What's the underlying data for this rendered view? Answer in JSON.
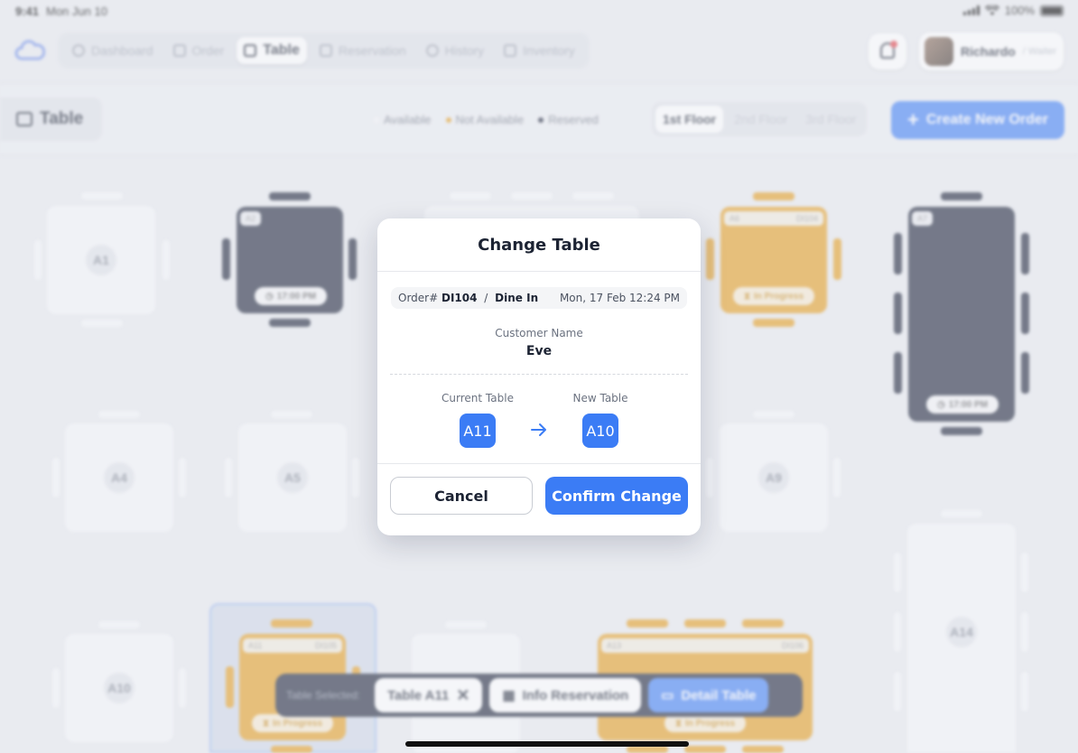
{
  "status_bar": {
    "time": "9:41",
    "date": "Mon Jun 10",
    "battery": "100%"
  },
  "nav": {
    "items": [
      {
        "label": "Dashboard",
        "icon": "dashboard-icon",
        "active": false
      },
      {
        "label": "Order",
        "icon": "order-icon",
        "active": false
      },
      {
        "label": "Table",
        "icon": "table-icon",
        "active": true
      },
      {
        "label": "Reservation",
        "icon": "calendar-icon",
        "active": false
      },
      {
        "label": "History",
        "icon": "history-icon",
        "active": false
      },
      {
        "label": "Inventory",
        "icon": "inventory-icon",
        "active": false
      }
    ]
  },
  "user": {
    "name": "Richardo",
    "role": "/ Waiter"
  },
  "toolbar": {
    "page_title": "Table",
    "legend": [
      {
        "label": "Available",
        "color": "#f6f7f9"
      },
      {
        "label": "Not Available",
        "color": "#e49b1a"
      },
      {
        "label": "Reserved",
        "color": "#161d33"
      }
    ],
    "floors": [
      "1st Floor",
      "2nd Floor",
      "3rd Floor"
    ],
    "create_label": "Create New Order"
  },
  "tables": {
    "a1": "A1",
    "a2": "A2",
    "a2_time": "17:00 PM",
    "a6": "A6",
    "a6_order": "DI104",
    "a6_status": "In Progress",
    "a7": "A7",
    "a7_time": "17:00 PM",
    "a4": "A4",
    "a5": "A5",
    "a9": "A9",
    "a10": "A10",
    "a11": "A11",
    "a11_order": "DI105",
    "a11_status": "In Progress",
    "a13": "A13",
    "a13_order": "DI106",
    "a13_status": "In Progress",
    "a14": "A14"
  },
  "selection_bar": {
    "label": "Table Selected:",
    "table": "Table A11",
    "info": "Info Reservation",
    "detail": "Detail Table"
  },
  "modal": {
    "title": "Change Table",
    "order_prefix": "Order#",
    "order_id": "DI104",
    "order_sep": "/",
    "order_type": "Dine In",
    "order_date": "Mon, 17 Feb 12:24 PM",
    "customer_label": "Customer Name",
    "customer_name": "Eve",
    "current_label": "Current Table",
    "current_table": "A11",
    "new_label": "New Table",
    "new_table": "A10",
    "cancel_label": "Cancel",
    "confirm_label": "Confirm Change"
  },
  "colors": {
    "accent": "#3b7cf5",
    "reserved": "#161d33",
    "not_available": "#e49b1a"
  }
}
